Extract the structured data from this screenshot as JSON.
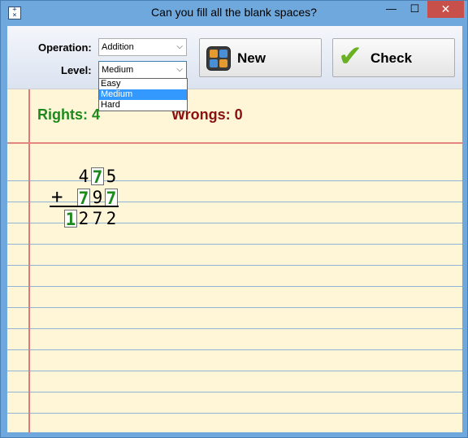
{
  "window": {
    "title": "Can you fill all the blank spaces?",
    "icon": "abacus-app-icon",
    "controls": {
      "minimize": "—",
      "maximize": "☐",
      "close": "✕"
    }
  },
  "toolbar": {
    "operation_label": "Operation:",
    "operation_value": "Addition",
    "level_label": "Level:",
    "level_value": "Medium",
    "level_options": [
      "Easy",
      "Medium",
      "Hard"
    ],
    "level_selected_index": 1,
    "new_label": "New",
    "check_label": "Check",
    "new_icon": "calculator-icon",
    "check_icon": "green-checkmark-icon"
  },
  "score": {
    "rights_text": "Rights: 4",
    "wrongs_text": "Wrongs: 0"
  },
  "problem": {
    "operator": "+",
    "rows": [
      {
        "digits": [
          "4",
          "7",
          "5"
        ],
        "boxed": [
          false,
          true,
          false
        ]
      },
      {
        "digits": [
          "7",
          "9",
          "7"
        ],
        "boxed": [
          true,
          false,
          true
        ]
      },
      {
        "digits": [
          "1",
          "2",
          "7",
          "2"
        ],
        "boxed": [
          true,
          false,
          false,
          false
        ]
      }
    ]
  },
  "colors": {
    "rights": "#1c8a1c",
    "wrongs": "#8b1010",
    "paper": "#fff6d8",
    "ruled_line": "#8fb4d8",
    "margin_line": "#e07a7a",
    "dropdown_highlight": "#3399ff"
  }
}
